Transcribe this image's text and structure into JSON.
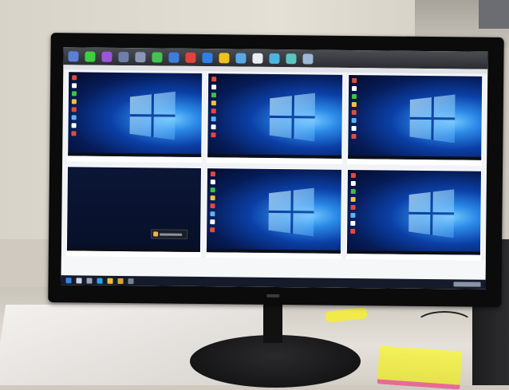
{
  "scene": {
    "description_tags": [
      "office-desk",
      "monitor",
      "remote-desktop-grid"
    ]
  },
  "monitor": {
    "toolbar": {
      "buttons": [
        {
          "icon": "dashboard-icon",
          "color": "#5b7fd6"
        },
        {
          "icon": "green-circle-icon",
          "color": "#3ecf3e"
        },
        {
          "icon": "purple-circle-icon",
          "color": "#9a55d9"
        },
        {
          "icon": "monitor-icon",
          "color": "#6d7ea8"
        },
        {
          "icon": "display-icon",
          "color": "#8a96b5"
        },
        {
          "icon": "green-app-icon",
          "color": "#43c24f"
        },
        {
          "icon": "blue-app-icon",
          "color": "#3e7de0"
        },
        {
          "icon": "red-app-icon",
          "color": "#e0433e"
        },
        {
          "icon": "blue-globe-icon",
          "color": "#2f7fe6"
        },
        {
          "icon": "yellow-app-icon",
          "color": "#f0c21f"
        },
        {
          "icon": "lightblue-app-icon",
          "color": "#58a8e8"
        },
        {
          "icon": "white-window-icon",
          "color": "#e9edf2"
        },
        {
          "icon": "gear-icon",
          "color": "#4bb5e0"
        },
        {
          "icon": "teal-app-icon",
          "color": "#59c6c1"
        },
        {
          "icon": "square-icon",
          "color": "#9fb7d9"
        }
      ]
    },
    "grid": [
      {
        "screen": "desktop",
        "wallpaper": "windows-10-hero"
      },
      {
        "screen": "desktop",
        "wallpaper": "windows-10-hero"
      },
      {
        "screen": "desktop",
        "wallpaper": "windows-10-hero"
      },
      {
        "screen": "lock-dark",
        "wallpaper": "dark-blue",
        "notification": true
      },
      {
        "screen": "desktop",
        "wallpaper": "windows-10-hero"
      },
      {
        "screen": "desktop",
        "wallpaper": "windows-10-hero"
      }
    ],
    "taskbar": {
      "items": [
        {
          "icon": "windows-start-icon",
          "color": "#2f86e6"
        },
        {
          "icon": "search-icon",
          "color": "#cfd6e3"
        },
        {
          "icon": "task-view-icon",
          "color": "#9aa4b8"
        },
        {
          "icon": "edge-icon",
          "color": "#2aa4e5"
        },
        {
          "icon": "folder-icon",
          "color": "#e8c23c"
        },
        {
          "icon": "chrome-icon",
          "color": "#d9a33a"
        },
        {
          "icon": "terminal-icon",
          "color": "#778196"
        }
      ]
    }
  }
}
